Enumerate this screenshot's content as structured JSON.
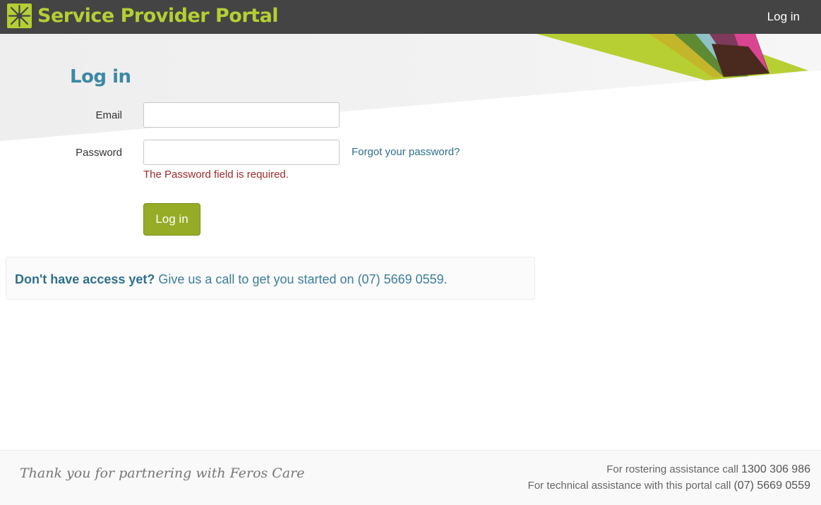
{
  "header": {
    "brand_title": "Service Provider Portal",
    "nav_login": "Log in",
    "logo_icon": "sunburst-logo-icon"
  },
  "form": {
    "heading": "Log in",
    "email_label": "Email",
    "email_value": "",
    "password_label": "Password",
    "password_value": "",
    "forgot_link": "Forgot your password?",
    "password_error": "The Password field is required.",
    "submit_label": "Log in"
  },
  "access": {
    "strong": "Don't have access yet?",
    "text": "Give us a call to get you started on",
    "phone": "(07) 5669 0559",
    "end": "."
  },
  "footer": {
    "thanks": "Thank you for partnering with Feros Care",
    "rostering_text": "For rostering assistance call",
    "rostering_phone": "1300 306 986",
    "technical_text": "For technical assistance with this portal call",
    "technical_phone": "(07) 5669 0559"
  },
  "colors": {
    "topbar": "#444444",
    "brand_green": "#b4cf34",
    "heading_blue": "#3d87a6",
    "button_green": "#97ac26",
    "error_red": "#9c2a2a",
    "link_blue": "#2b6f8c"
  }
}
